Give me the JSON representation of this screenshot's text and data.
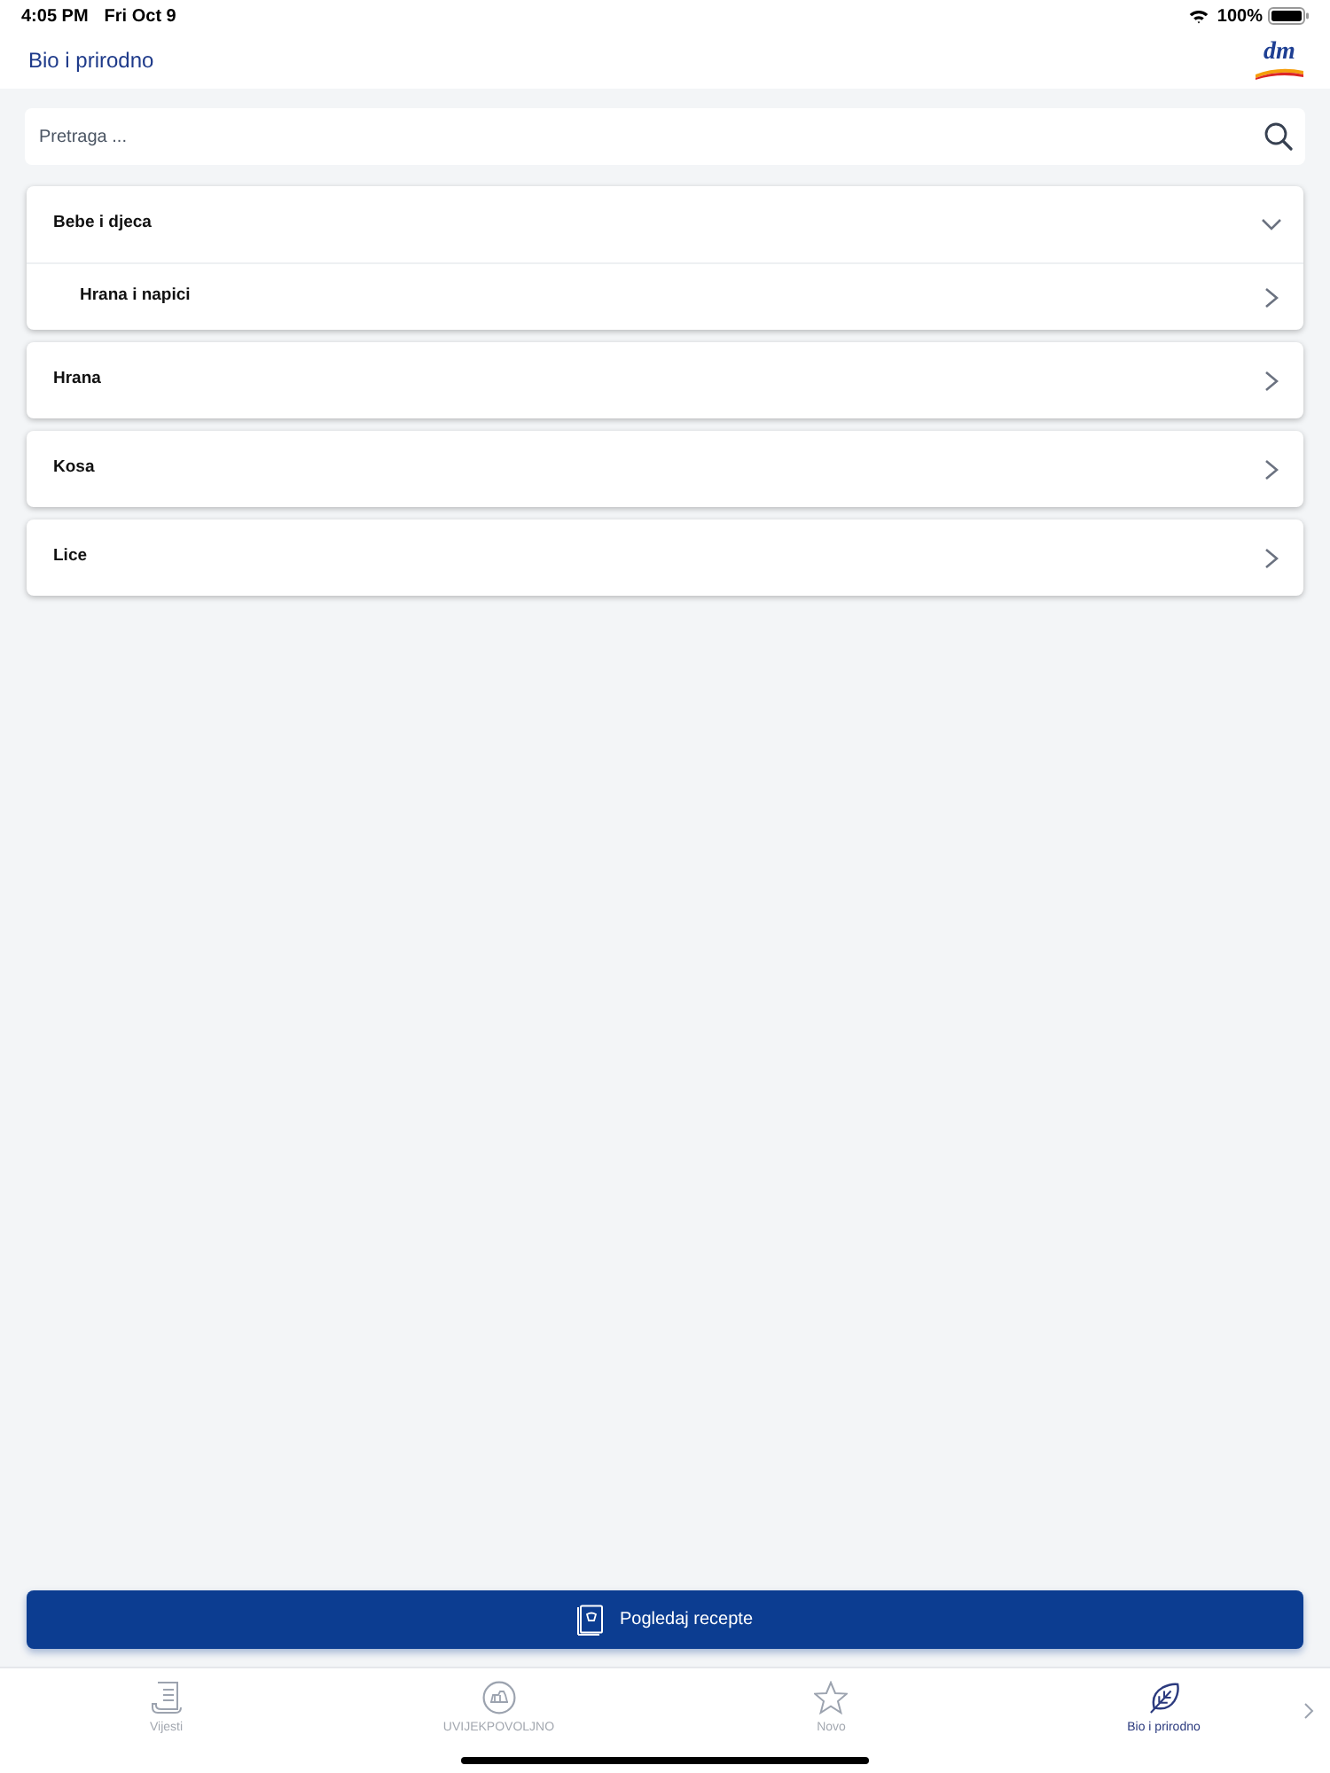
{
  "status_bar": {
    "time": "4:05 PM",
    "date": "Fri Oct 9",
    "battery": "100%"
  },
  "header": {
    "title": "Bio i prirodno",
    "logo": "dm"
  },
  "search": {
    "placeholder": "Pretraga ..."
  },
  "categories": [
    {
      "label": "Bebe i djeca",
      "expanded": true,
      "children": [
        {
          "label": "Hrana i napici"
        }
      ]
    },
    {
      "label": "Hrana",
      "expanded": false
    },
    {
      "label": "Kosa",
      "expanded": false
    },
    {
      "label": "Lice",
      "expanded": false
    }
  ],
  "action_button": {
    "label": "Pogledaj recepte"
  },
  "tabs": [
    {
      "label": "Vijesti",
      "selected": false
    },
    {
      "label": "UVIJEKPOVOLJNO",
      "selected": false
    },
    {
      "label": "Novo",
      "selected": false
    },
    {
      "label": "Bio i prirodno",
      "selected": true
    }
  ]
}
